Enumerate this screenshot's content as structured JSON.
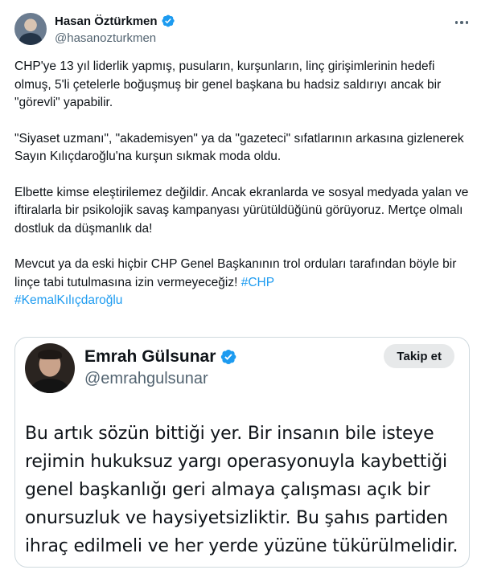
{
  "author": {
    "name": "Hasan Öztürkmen",
    "handle": "@hasanozturkmen"
  },
  "tweet": {
    "paragraphs": [
      "CHP'ye 13 yıl liderlik yapmış, pusuların, kurşunların, linç girişimlerinin hedefi olmuş, 5'li çetelerle boğuşmuş bir genel başkana bu hadsiz saldırıyı ancak bir \"görevli\" yapabilir.",
      "\"Siyaset uzmanı\", \"akademisyen\" ya da \"gazeteci\" sıfatlarının arkasına gizlenerek Sayın Kılıçdaroğlu'na kurşun sıkmak moda oldu.",
      "Elbette kimse eleştirilemez değildir. Ancak ekranlarda ve sosyal medyada yalan ve iftiralarla bir psikolojik savaş kampanyası yürütüldüğünü görüyoruz. Mertçe olmalı dostluk da düşmanlık da!"
    ],
    "last_paragraph": "Mevcut ya da eski hiçbir CHP Genel Başkanının trol orduları tarafından böyle bir linçe tabi tutulmasına izin vermeyeceğiz!",
    "hashtags": [
      "#CHP",
      "#KemalKılıçdaroğlu"
    ]
  },
  "quoted": {
    "name": "Emrah Gülsunar",
    "handle": "@emrahgulsunar",
    "follow_label": "Takip et",
    "text": "Bu artık sözün bittiği yer. Bir insanın bile isteye rejimin hukuksuz yargı operasyonuyla kaybettiği genel başkanlığı geri almaya çalışması açık bir onursuzluk ve haysiyetsizliktir. Bu şahıs partiden ihraç edilmeli ve her yerde yüzüne tükürülmelidir."
  },
  "colors": {
    "accent": "#1d9bf0",
    "text": "#0f1419",
    "muted": "#536471",
    "border": "#cfd9de",
    "follow_bg": "#e7e9ea"
  },
  "icons": {
    "verified": "verified-badge-icon",
    "more": "more-options-icon"
  }
}
